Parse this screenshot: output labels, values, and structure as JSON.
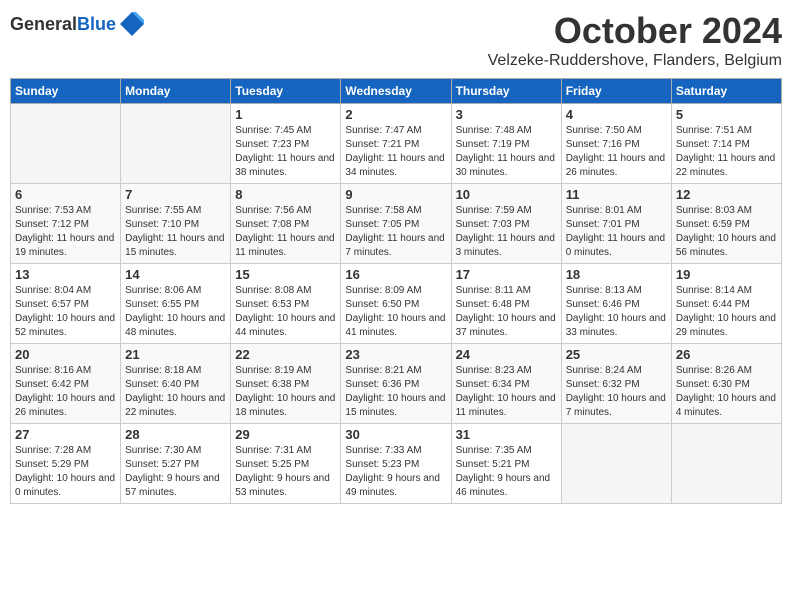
{
  "header": {
    "logo_general": "General",
    "logo_blue": "Blue",
    "month": "October 2024",
    "location": "Velzeke-Ruddershove, Flanders, Belgium"
  },
  "weekdays": [
    "Sunday",
    "Monday",
    "Tuesday",
    "Wednesday",
    "Thursday",
    "Friday",
    "Saturday"
  ],
  "weeks": [
    [
      {
        "day": "",
        "info": ""
      },
      {
        "day": "",
        "info": ""
      },
      {
        "day": "1",
        "info": "Sunrise: 7:45 AM\nSunset: 7:23 PM\nDaylight: 11 hours and 38 minutes."
      },
      {
        "day": "2",
        "info": "Sunrise: 7:47 AM\nSunset: 7:21 PM\nDaylight: 11 hours and 34 minutes."
      },
      {
        "day": "3",
        "info": "Sunrise: 7:48 AM\nSunset: 7:19 PM\nDaylight: 11 hours and 30 minutes."
      },
      {
        "day": "4",
        "info": "Sunrise: 7:50 AM\nSunset: 7:16 PM\nDaylight: 11 hours and 26 minutes."
      },
      {
        "day": "5",
        "info": "Sunrise: 7:51 AM\nSunset: 7:14 PM\nDaylight: 11 hours and 22 minutes."
      }
    ],
    [
      {
        "day": "6",
        "info": "Sunrise: 7:53 AM\nSunset: 7:12 PM\nDaylight: 11 hours and 19 minutes."
      },
      {
        "day": "7",
        "info": "Sunrise: 7:55 AM\nSunset: 7:10 PM\nDaylight: 11 hours and 15 minutes."
      },
      {
        "day": "8",
        "info": "Sunrise: 7:56 AM\nSunset: 7:08 PM\nDaylight: 11 hours and 11 minutes."
      },
      {
        "day": "9",
        "info": "Sunrise: 7:58 AM\nSunset: 7:05 PM\nDaylight: 11 hours and 7 minutes."
      },
      {
        "day": "10",
        "info": "Sunrise: 7:59 AM\nSunset: 7:03 PM\nDaylight: 11 hours and 3 minutes."
      },
      {
        "day": "11",
        "info": "Sunrise: 8:01 AM\nSunset: 7:01 PM\nDaylight: 11 hours and 0 minutes."
      },
      {
        "day": "12",
        "info": "Sunrise: 8:03 AM\nSunset: 6:59 PM\nDaylight: 10 hours and 56 minutes."
      }
    ],
    [
      {
        "day": "13",
        "info": "Sunrise: 8:04 AM\nSunset: 6:57 PM\nDaylight: 10 hours and 52 minutes."
      },
      {
        "day": "14",
        "info": "Sunrise: 8:06 AM\nSunset: 6:55 PM\nDaylight: 10 hours and 48 minutes."
      },
      {
        "day": "15",
        "info": "Sunrise: 8:08 AM\nSunset: 6:53 PM\nDaylight: 10 hours and 44 minutes."
      },
      {
        "day": "16",
        "info": "Sunrise: 8:09 AM\nSunset: 6:50 PM\nDaylight: 10 hours and 41 minutes."
      },
      {
        "day": "17",
        "info": "Sunrise: 8:11 AM\nSunset: 6:48 PM\nDaylight: 10 hours and 37 minutes."
      },
      {
        "day": "18",
        "info": "Sunrise: 8:13 AM\nSunset: 6:46 PM\nDaylight: 10 hours and 33 minutes."
      },
      {
        "day": "19",
        "info": "Sunrise: 8:14 AM\nSunset: 6:44 PM\nDaylight: 10 hours and 29 minutes."
      }
    ],
    [
      {
        "day": "20",
        "info": "Sunrise: 8:16 AM\nSunset: 6:42 PM\nDaylight: 10 hours and 26 minutes."
      },
      {
        "day": "21",
        "info": "Sunrise: 8:18 AM\nSunset: 6:40 PM\nDaylight: 10 hours and 22 minutes."
      },
      {
        "day": "22",
        "info": "Sunrise: 8:19 AM\nSunset: 6:38 PM\nDaylight: 10 hours and 18 minutes."
      },
      {
        "day": "23",
        "info": "Sunrise: 8:21 AM\nSunset: 6:36 PM\nDaylight: 10 hours and 15 minutes."
      },
      {
        "day": "24",
        "info": "Sunrise: 8:23 AM\nSunset: 6:34 PM\nDaylight: 10 hours and 11 minutes."
      },
      {
        "day": "25",
        "info": "Sunrise: 8:24 AM\nSunset: 6:32 PM\nDaylight: 10 hours and 7 minutes."
      },
      {
        "day": "26",
        "info": "Sunrise: 8:26 AM\nSunset: 6:30 PM\nDaylight: 10 hours and 4 minutes."
      }
    ],
    [
      {
        "day": "27",
        "info": "Sunrise: 7:28 AM\nSunset: 5:29 PM\nDaylight: 10 hours and 0 minutes."
      },
      {
        "day": "28",
        "info": "Sunrise: 7:30 AM\nSunset: 5:27 PM\nDaylight: 9 hours and 57 minutes."
      },
      {
        "day": "29",
        "info": "Sunrise: 7:31 AM\nSunset: 5:25 PM\nDaylight: 9 hours and 53 minutes."
      },
      {
        "day": "30",
        "info": "Sunrise: 7:33 AM\nSunset: 5:23 PM\nDaylight: 9 hours and 49 minutes."
      },
      {
        "day": "31",
        "info": "Sunrise: 7:35 AM\nSunset: 5:21 PM\nDaylight: 9 hours and 46 minutes."
      },
      {
        "day": "",
        "info": ""
      },
      {
        "day": "",
        "info": ""
      }
    ]
  ]
}
